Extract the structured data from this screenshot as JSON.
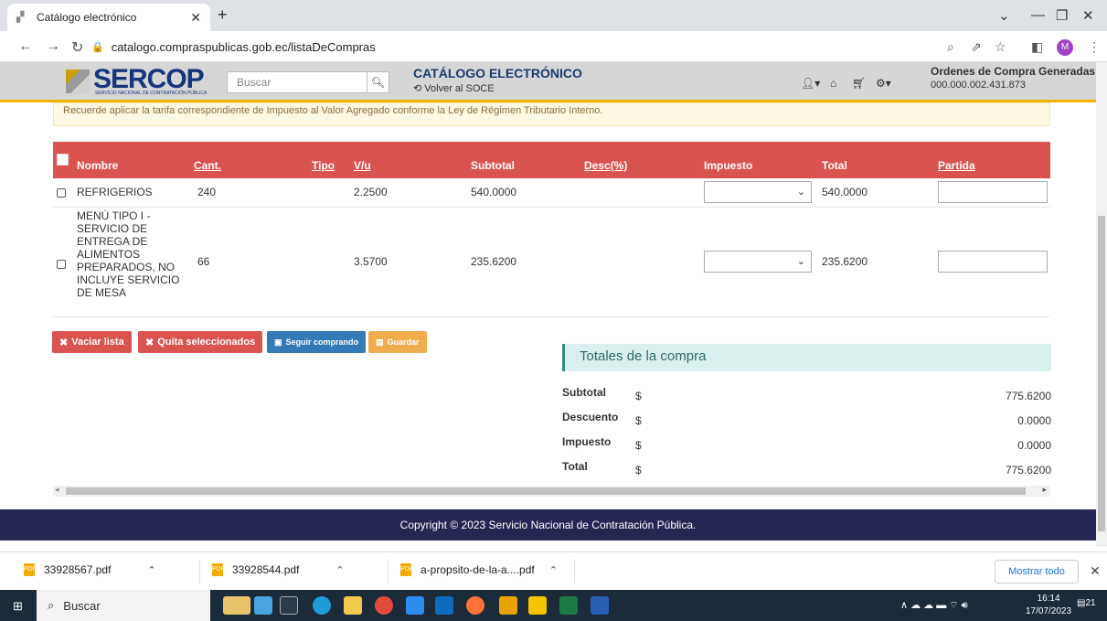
{
  "browser": {
    "tab_title": "Catálogo electrónico",
    "url": "catalogo.compraspublicas.gob.ec/listaDeCompras",
    "avatar_letter": "M"
  },
  "header": {
    "logo_text": "SERCOP",
    "logo_sub": "SERVICIO NACIONAL DE CONTRATACIÓN PÚBLICA",
    "search_placeholder": "Buscar",
    "catalog_title": "CATÁLOGO ELECTRÓNICO",
    "back_link": "Volver al SOCE",
    "orders_title": "Ordenes de Compra Generadas",
    "orders_number": "000.000.002.431.873"
  },
  "notice": "Recuerde aplicar la tarifa correspondiente de Impuesto al Valor Agregado conforme la Ley de Régimen Tributario Interno.",
  "table": {
    "headers": [
      "Nombre",
      "Cant.",
      "Tipo",
      "V/u",
      "Subtotal",
      "Desc(%)",
      "Impuesto",
      "Total",
      "Partida"
    ],
    "rows": [
      {
        "nombre": "REFRIGERIOS",
        "cant": "240",
        "tipo": "",
        "vu": "2.2500",
        "subtotal": "540.0000",
        "desc": "",
        "total": "540.0000"
      },
      {
        "nombre": "MENÚ TIPO I - SERVICIO DE ENTREGA DE ALIMENTOS PREPARADOS, NO INCLUYE SERVICIO DE MESA",
        "cant": "66",
        "tipo": "",
        "vu": "3.5700",
        "subtotal": "235.6200",
        "desc": "",
        "total": "235.6200"
      }
    ]
  },
  "buttons": {
    "vaciar": "Vaciar lista",
    "quitar": "Quita seleccionados",
    "seguir": "Seguir comprando",
    "guardar": "Guardar"
  },
  "totals": {
    "title": "Totales de la compra",
    "currency": "$",
    "items": [
      {
        "label": "Subtotal",
        "value": "775.6200"
      },
      {
        "label": "Descuento",
        "value": "0.0000"
      },
      {
        "label": "Impuesto",
        "value": "0.0000"
      },
      {
        "label": "Total",
        "value": "775.6200"
      }
    ]
  },
  "footer": "Copyright © 2023 Servicio Nacional de Contratación Pública.",
  "downloads": {
    "files": [
      "33928567.pdf",
      "33928544.pdf",
      "a-propsito-de-la-a....pdf"
    ],
    "show_all": "Mostrar todo"
  },
  "taskbar": {
    "search": "Buscar",
    "time": "16:14",
    "date": "17/07/2023",
    "notifications": "21"
  }
}
